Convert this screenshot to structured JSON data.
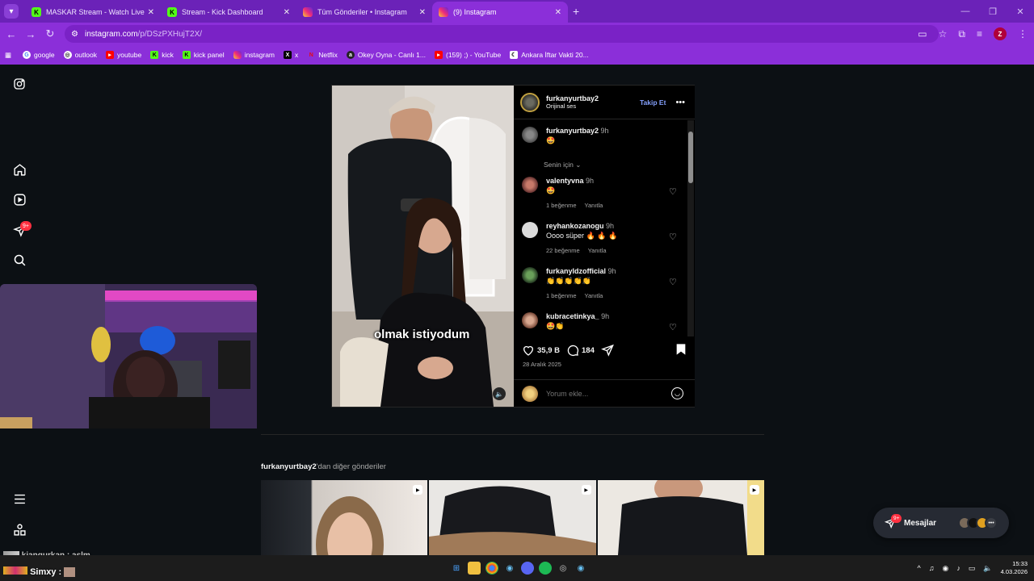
{
  "browser": {
    "tabs": [
      {
        "title": "MASKAR Stream - Watch Live o",
        "favicon": "kick",
        "active": false
      },
      {
        "title": "Stream - Kick Dashboard",
        "favicon": "kick",
        "active": false
      },
      {
        "title": "Tüm Gönderiler • Instagram",
        "favicon": "instagram",
        "active": false
      },
      {
        "title": "(9) Instagram",
        "favicon": "instagram",
        "active": true
      }
    ],
    "url_host": "instagram.com",
    "url_path": "/p/DSzPXHujT2X/",
    "profile_initial": "Z",
    "bookmarks": [
      "google",
      "outlook",
      "youtube",
      "kick",
      "kick panel",
      "instagram",
      "x",
      "Netflix",
      "Okey Oyna - Canlı 1...",
      "(159) ;) - YouTube",
      "Ankara İftar Vakti 20..."
    ]
  },
  "sidebar": {
    "notification_badge": "9+"
  },
  "post": {
    "author": "furkanyurtbay2",
    "audio": "Orijinal ses",
    "follow_label": "Takip Et",
    "caption_overlay": "olmak istiyodum",
    "caption_comment": {
      "user": "furkanyurtbay2",
      "time": "9h",
      "text": "🤩"
    },
    "sort_label": "Senin için",
    "comments": [
      {
        "user": "valentyvna",
        "time": "9h",
        "text": "🤩",
        "likes": "1 beğenme",
        "reply": "Yanıtla"
      },
      {
        "user": "reyhankozanogu",
        "time": "9h",
        "text": "Oooo süper 🔥 🔥 🔥",
        "likes": "22 beğenme",
        "reply": "Yanıtla"
      },
      {
        "user": "furkanyldzofficial",
        "time": "9h",
        "text": "👏👏👏👏👏",
        "likes": "1 beğenme",
        "reply": "Yanıtla"
      },
      {
        "user": "kubracetinkya_",
        "time": "9h",
        "text": "🤩👏",
        "likes": "",
        "reply": ""
      }
    ],
    "like_count": "35,9 B",
    "comment_count": "184",
    "date": "28 Aralık 2025",
    "comment_placeholder": "Yorum ekle..."
  },
  "more_posts": {
    "title_user": "furkanyurtbay2",
    "title_suffix": "'dan diğer gönderiler"
  },
  "messages": {
    "label": "Mesajlar",
    "badge": "9+"
  },
  "stream_chat": [
    {
      "user": "kiangurkan",
      "text": ": aslm"
    },
    {
      "user": "Simxy",
      "text": ":"
    }
  ],
  "clock": {
    "time": "15:33",
    "date": "4.03.2026"
  },
  "colors": {
    "accent": "#8b2fd9",
    "instagram_link": "#85a1ff",
    "badge": "#ff3040"
  }
}
